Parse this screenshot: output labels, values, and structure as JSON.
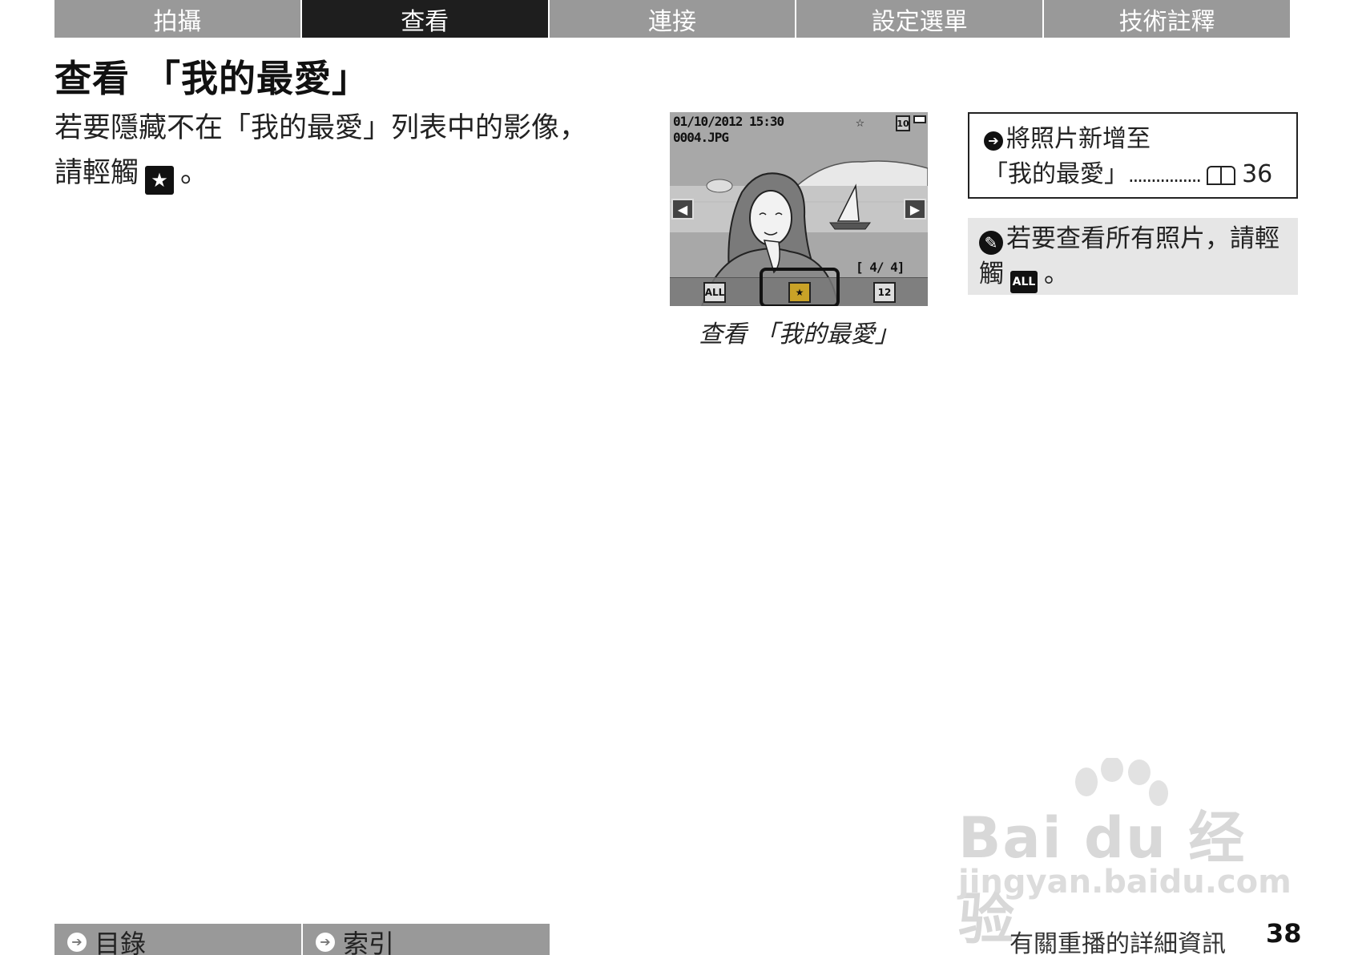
{
  "tabs": [
    {
      "label": "拍攝",
      "active": false
    },
    {
      "label": "查看",
      "active": true
    },
    {
      "label": "連接",
      "active": false
    },
    {
      "label": "設定選單",
      "active": false
    },
    {
      "label": "技術註釋",
      "active": false
    }
  ],
  "page_title": "查看 「我的最愛」",
  "body": {
    "line1": "若要隱藏不在「我的最愛」列表中的影像，",
    "line2_prefix": "請輕觸",
    "line2_suffix": "。",
    "icon_name": "favorite-star-icon"
  },
  "camera_screen": {
    "date_time": "01/10/2012  15:30",
    "filename": "0004.JPG",
    "star": "☆",
    "memory_icon": "10",
    "counter": "[   4/   4]",
    "left_arrow": "◀",
    "right_arrow": "▶",
    "btn_all": "ALL",
    "btn_fav": "★",
    "btn_date": "12"
  },
  "caption": "查看 「我的最愛」",
  "ref_box": {
    "arrow": "➔",
    "line1": "將照片新增至",
    "line2": "「我的最愛」",
    "dots": "................",
    "page": "36"
  },
  "note_box": {
    "icon": "✎",
    "line1": "若要查看所有照片，請輕",
    "line2_prefix": "觸",
    "all_label": "ALL",
    "line2_suffix": "。"
  },
  "watermark": {
    "main": "Bai du 经验",
    "sub": "jingyan.baidu.com"
  },
  "bottom_nav": [
    {
      "label": "目錄",
      "arrow": "➔"
    },
    {
      "label": "索引",
      "arrow": "➔"
    }
  ],
  "footer": {
    "section_label": "有關重播的詳細資訊",
    "page_number": "38"
  },
  "colors": {
    "tab_bg": "#999999",
    "tab_active_bg": "#1e1e1e",
    "note_bg": "#e6e6e6",
    "fav_button": "#c9a227"
  }
}
